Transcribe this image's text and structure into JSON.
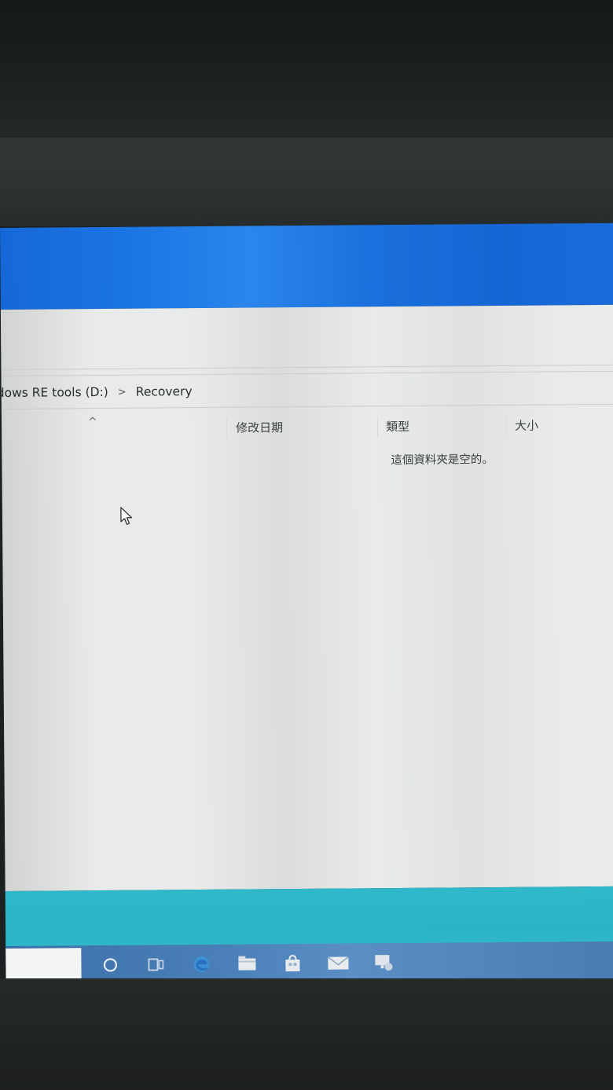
{
  "address_bar": {
    "crumbs": [
      "dows RE tools (D:)",
      "Recovery"
    ],
    "separator": ">"
  },
  "columns": {
    "sort_indicator": "^",
    "date_modified": "修改日期",
    "type": "類型",
    "size": "大小"
  },
  "file_list": {
    "empty_message": "這個資料夾是空的。"
  },
  "taskbar": {
    "items": [
      {
        "icon": "cortana-circle-icon"
      },
      {
        "icon": "task-view-icon"
      },
      {
        "icon": "edge-browser-icon"
      },
      {
        "icon": "file-explorer-icon"
      },
      {
        "icon": "store-bag-icon"
      },
      {
        "icon": "mail-icon"
      },
      {
        "icon": "network-icon"
      }
    ]
  },
  "colors": {
    "title_bar": "#1a70dc",
    "window_bg": "#e8ebea",
    "taskbar_strip": "#2fb8c9",
    "taskbar": "#4a7fb8"
  }
}
